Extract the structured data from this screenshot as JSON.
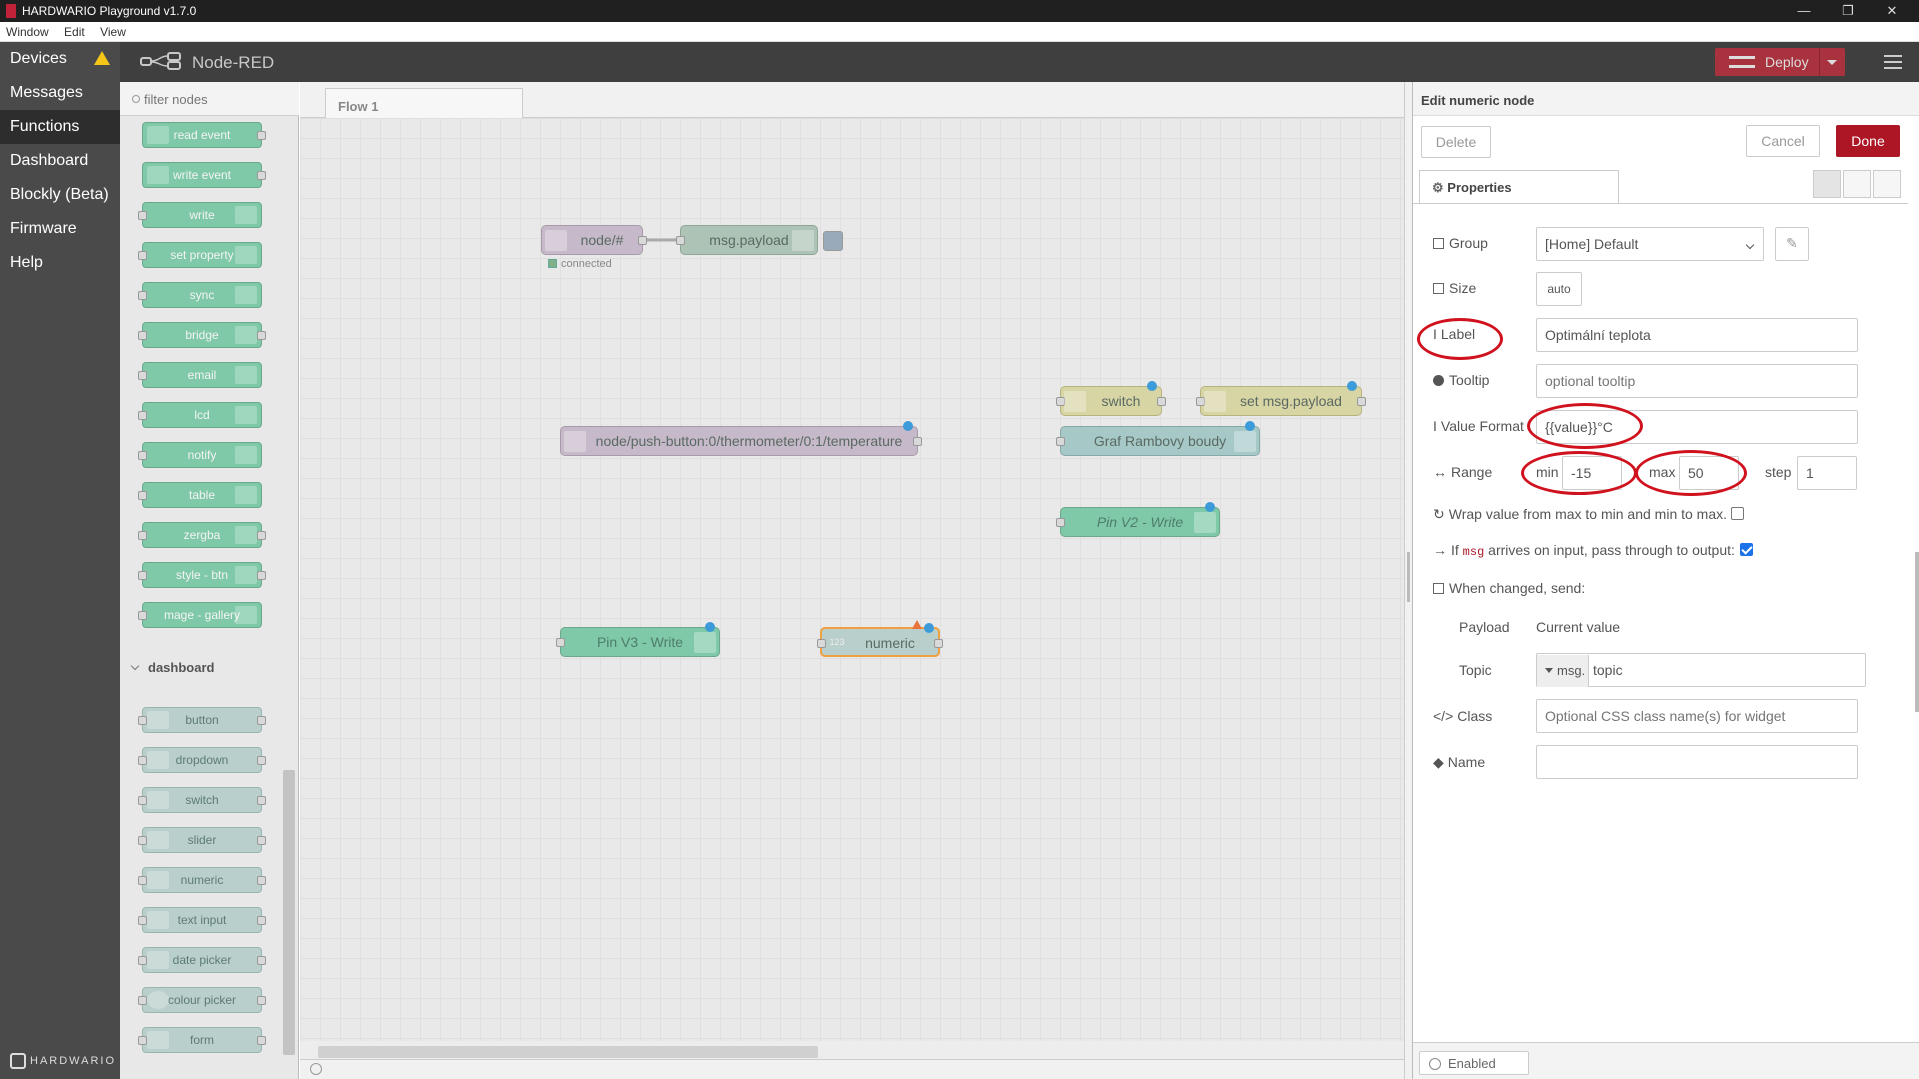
{
  "window": {
    "title": "HARDWARIO Playground v1.7.0",
    "menu": [
      "Window",
      "Edit",
      "View"
    ],
    "controls": [
      "—",
      "❐",
      "✕"
    ]
  },
  "appnav": {
    "items": [
      {
        "label": "Devices"
      },
      {
        "label": "Messages"
      },
      {
        "label": "Functions"
      },
      {
        "label": "Dashboard"
      },
      {
        "label": "Blockly (Beta)"
      },
      {
        "label": "Firmware"
      },
      {
        "label": "Help"
      }
    ],
    "brand": "HARDWARIO"
  },
  "header": {
    "app_name": "Node-RED",
    "deploy_label": "Deploy"
  },
  "palette": {
    "filter_placeholder": "filter nodes",
    "nodes": [
      "read event",
      "write event",
      "write",
      "set property",
      "sync",
      "bridge",
      "email",
      "lcd",
      "notify",
      "table",
      "zergba",
      "style - btn",
      "mage - gallery"
    ],
    "category": "dashboard",
    "dashboard_nodes": [
      "button",
      "dropdown",
      "switch",
      "slider",
      "numeric",
      "text input",
      "date picker",
      "colour picker",
      "form"
    ]
  },
  "workspace": {
    "tab": "Flow 1",
    "nodes": {
      "mqtt_in": "node/#",
      "mqtt_status": "connected",
      "debug": "msg.payload",
      "switch": "switch",
      "set_payload": "set msg.payload",
      "temperature": "node/push-button:0/thermometer/0:1/temperature",
      "gauge": "Graf Rambovy boudy",
      "pin_v2": "Pin V2 - Write",
      "pin_v3": "Pin V3 - Write",
      "numeric": "numeric",
      "numeric_icon": "123"
    }
  },
  "tray": {
    "title": "Edit numeric node",
    "delete": "Delete",
    "cancel": "Cancel",
    "done": "Done",
    "properties_tab": "Properties",
    "group": {
      "label": "Group",
      "value": "[Home] Default"
    },
    "size": {
      "label": "Size",
      "value": "auto"
    },
    "label_field": {
      "label": "Label",
      "value": "Optimální teplota"
    },
    "tooltip": {
      "label": "Tooltip",
      "placeholder": "optional tooltip"
    },
    "value_format": {
      "label": "Value Format",
      "value": "{{value}}°C"
    },
    "range": {
      "label": "Range",
      "min_label": "min",
      "min": "-15",
      "max_label": "max",
      "max": "50",
      "step_label": "step",
      "step": "1"
    },
    "wrap_label": "Wrap value from max to min and min to max.",
    "wrap_checked": false,
    "passthrough_prefix": "If",
    "passthrough_code": "msg",
    "passthrough_suffix": "arrives on input, pass through to output:",
    "passthrough_checked": true,
    "when_changed": "When changed, send:",
    "payload_label": "Payload",
    "payload_value": "Current value",
    "topic_label": "Topic",
    "topic_prefix": "msg.",
    "topic_value": "topic",
    "class": {
      "label": "Class",
      "placeholder": "Optional CSS class name(s) for widget"
    },
    "name": {
      "label": "Name",
      "value": ""
    },
    "enabled": "Enabled"
  },
  "colors": {
    "accent": "#ad1625",
    "annotation": "#d0121e",
    "sidebar": "#4a4a4a",
    "header": "#3f3f3f"
  }
}
